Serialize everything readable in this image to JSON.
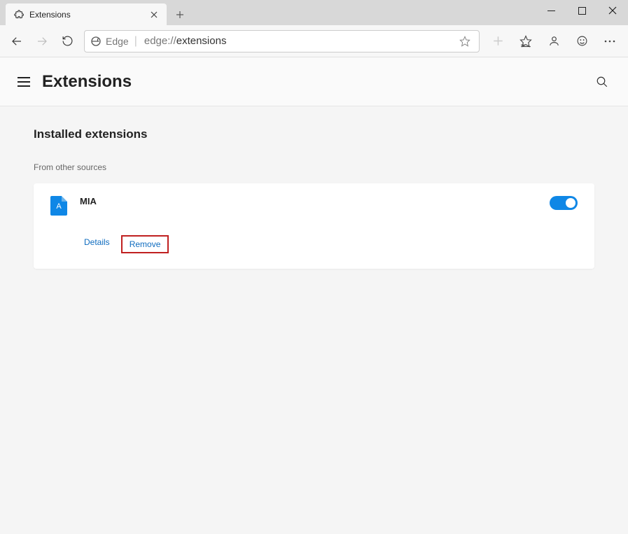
{
  "tab": {
    "title": "Extensions"
  },
  "address": {
    "label": "Edge",
    "prefix": "edge://",
    "path": "extensions"
  },
  "header": {
    "title": "Extensions"
  },
  "section": {
    "title": "Installed extensions",
    "source_label": "From other sources"
  },
  "extension": {
    "name": "MIA",
    "icon_letter": "A",
    "details_label": "Details",
    "remove_label": "Remove",
    "enabled": true
  }
}
